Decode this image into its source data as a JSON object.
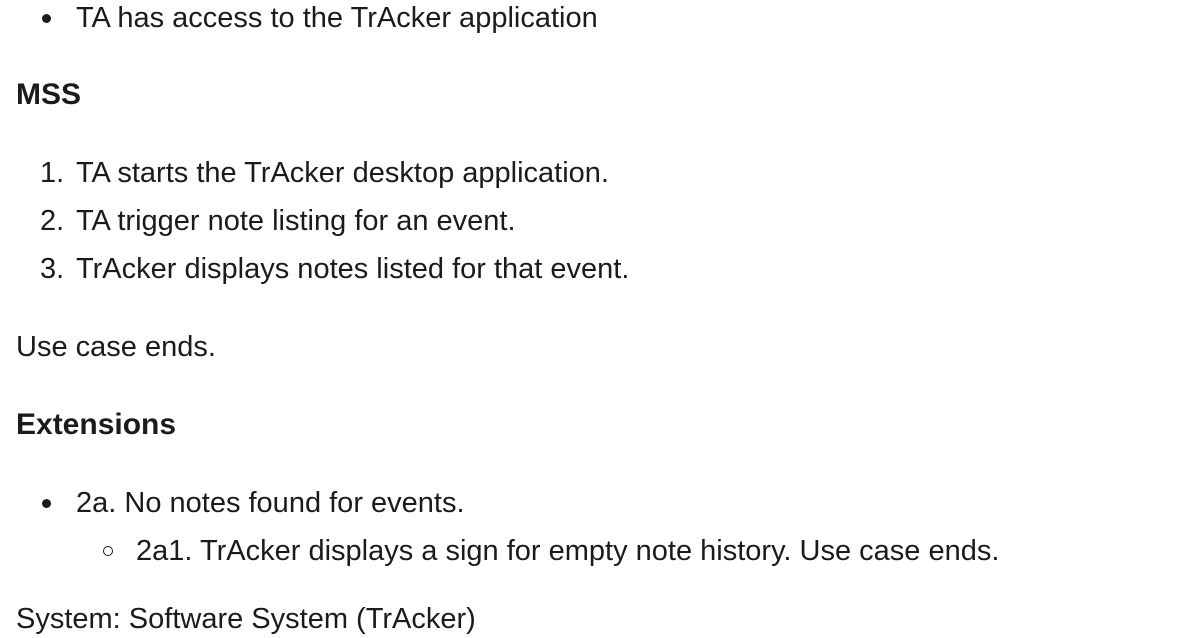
{
  "preconditions": {
    "items": [
      "TA has access to the TrAcker application"
    ]
  },
  "mss": {
    "heading": "MSS",
    "steps": [
      {
        "num": "1.",
        "text": "TA starts the TrAcker desktop application."
      },
      {
        "num": "2.",
        "text": "TA trigger note listing for an event."
      },
      {
        "num": "3.",
        "text": "TrAcker displays notes listed for that event."
      }
    ],
    "end_text": "Use case ends."
  },
  "extensions": {
    "heading": "Extensions",
    "items": [
      {
        "text": "2a. No notes found for events.",
        "sub": [
          "2a1. TrAcker displays a sign for empty note history. Use case ends."
        ]
      }
    ]
  },
  "next_section": {
    "title": "System: Software System (TrAcker)"
  }
}
